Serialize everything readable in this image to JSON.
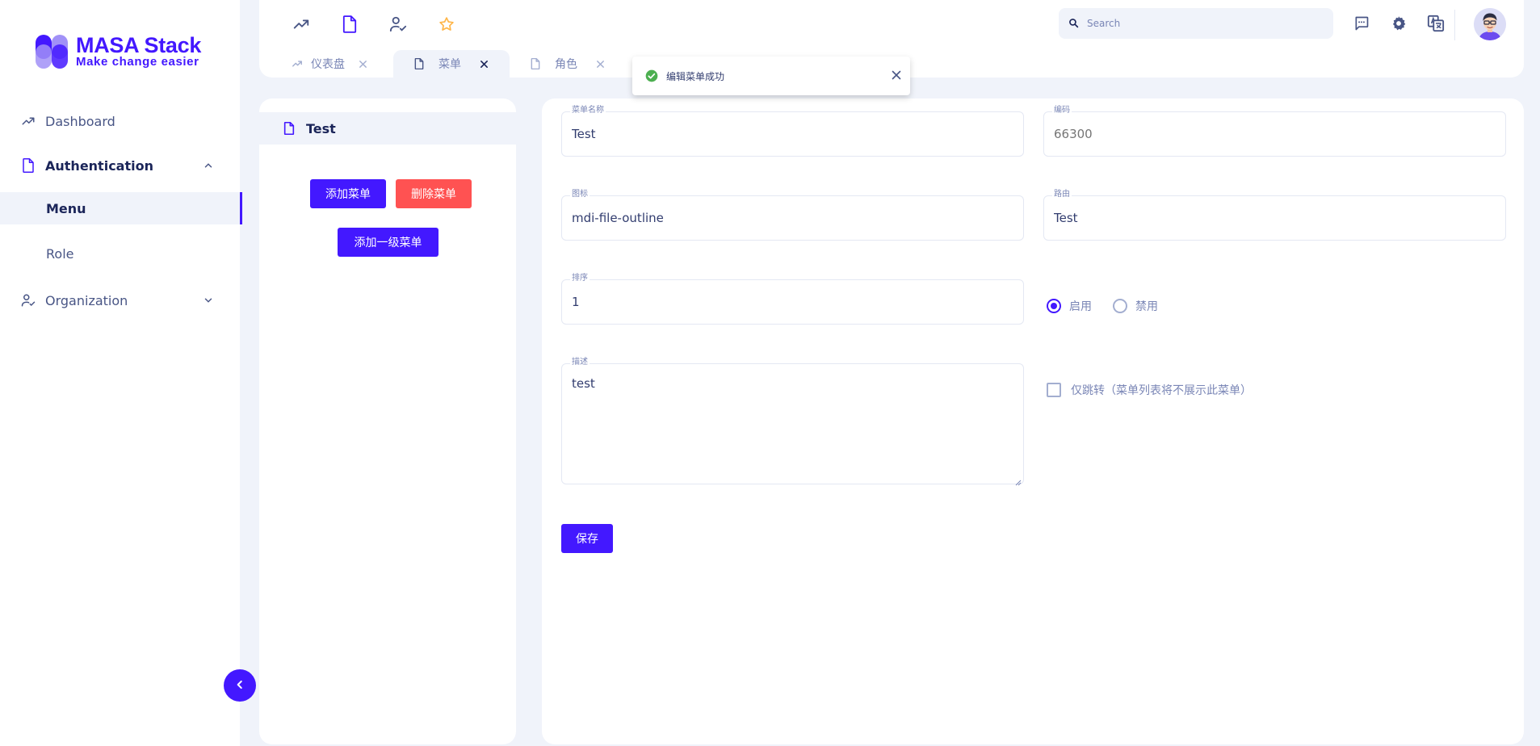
{
  "app": {
    "logo_title": "MASA Stack",
    "logo_subtitle": "Make change easier"
  },
  "colors": {
    "accent": "#4318FF",
    "danger": "#FF5252",
    "success": "#4CAF50",
    "background": "#F0F3FA"
  },
  "sidebar": {
    "items": [
      {
        "label": "Dashboard",
        "icon": "trending-up-icon"
      },
      {
        "label": "Authentication",
        "icon": "file-outline-icon",
        "expanded": true,
        "children": [
          {
            "label": "Menu",
            "active": true
          },
          {
            "label": "Role"
          }
        ]
      },
      {
        "label": "Organization",
        "icon": "account-check-icon"
      }
    ]
  },
  "header": {
    "quick_icons": [
      "trending-up-icon",
      "file-outline-icon",
      "account-check-icon",
      "star-icon"
    ],
    "search_placeholder": "Search",
    "right_icons": [
      "message-icon",
      "gear-icon",
      "translate-icon"
    ],
    "avatar": "user-avatar"
  },
  "tabs": [
    {
      "label": "仪表盘",
      "icon": "trending-up-icon",
      "active": false
    },
    {
      "label": "菜单",
      "icon": "file-outline-icon",
      "active": true
    },
    {
      "label": "角色",
      "icon": "file-outline-icon",
      "active": false
    }
  ],
  "toast": {
    "message": "编辑菜单成功",
    "icon": "check-circle-icon"
  },
  "tree": {
    "selected": "Test"
  },
  "actions": {
    "add_menu": "添加菜单",
    "delete_menu": "删除菜单",
    "add_top_menu": "添加一级菜单"
  },
  "form": {
    "name_label": "菜单名称",
    "name_value": "Test",
    "code_label": "编码",
    "code_placeholder": "66300",
    "icon_label": "图标",
    "icon_value": "mdi-file-outline",
    "route_label": "路由",
    "route_value": "Test",
    "order_label": "排序",
    "order_value": "1",
    "enable_label": "启用",
    "disable_label": "禁用",
    "status": "enabled",
    "desc_label": "描述",
    "desc_value": "test",
    "jump_only_label": "仅跳转（菜单列表将不展示此菜单）",
    "save_label": "保存"
  }
}
